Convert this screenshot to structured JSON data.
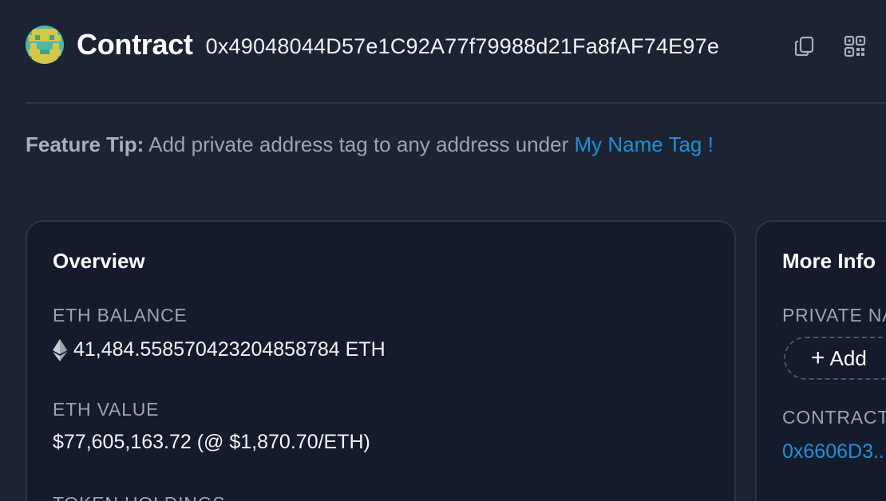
{
  "header": {
    "title": "Contract",
    "address": "0x49048044D57e1C92A77f79988d21Fa8fAF74E97e",
    "copy_icon": "copy-icon",
    "qr_icon": "qr-code-icon"
  },
  "tip": {
    "label": "Feature Tip:",
    "text": " Add private address tag to any address under ",
    "link": "My Name Tag !"
  },
  "overview": {
    "title": "Overview",
    "eth_balance_label": "ETH BALANCE",
    "eth_balance_value": "41,484.558570423204858784 ETH",
    "eth_value_label": "ETH VALUE",
    "eth_value_value": "$77,605,163.72 (@ $1,870.70/ETH)",
    "token_holdings_label": "TOKEN HOLDINGS"
  },
  "more_info": {
    "title": "More Info",
    "private_name_label": "PRIVATE NAME TAGS",
    "add_label": "Add",
    "contract_creator_label": "CONTRACT CREATOR:",
    "contract_creator_value": "0x6606D3..."
  },
  "colors": {
    "background": "#1c2333",
    "card": "#141b2c",
    "link": "#1e91d6",
    "muted": "#9aa4b2"
  }
}
